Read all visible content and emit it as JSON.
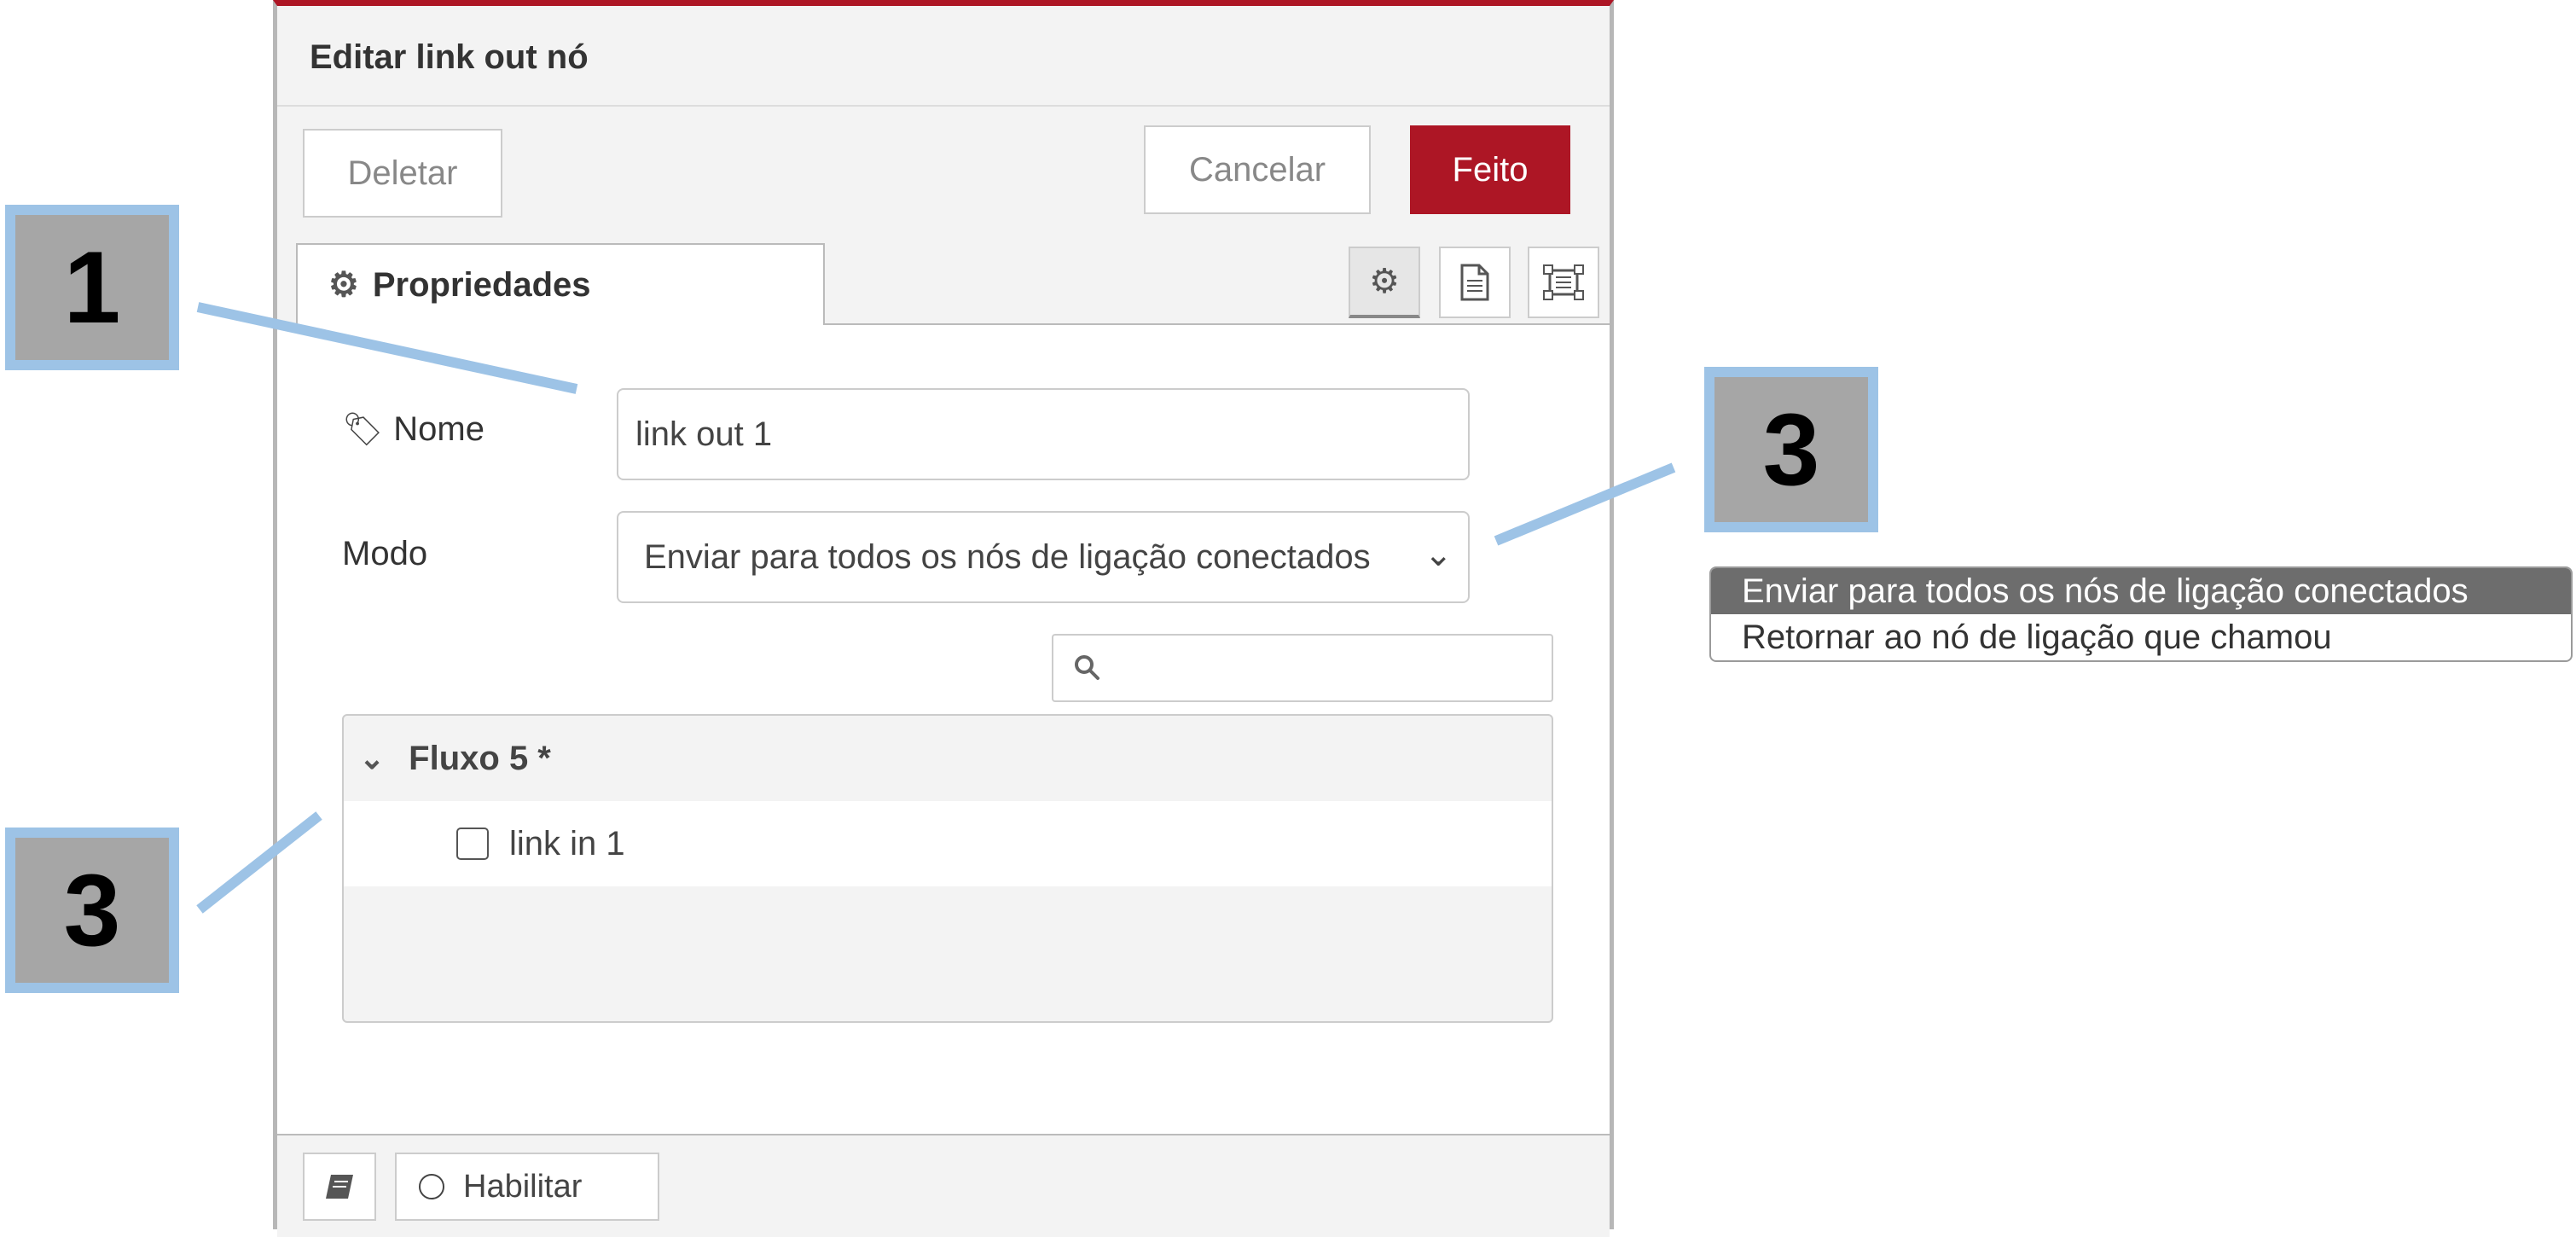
{
  "editor": {
    "title": "Editar link out nó",
    "buttons": {
      "delete": "Deletar",
      "cancel": "Cancelar",
      "done": "Feito"
    },
    "tabs": {
      "properties_label": "Propriedades",
      "icons": [
        "gear-icon",
        "document-icon",
        "frame-icon"
      ]
    },
    "form": {
      "name_label": "Nome",
      "name_value": "link out 1",
      "mode_label": "Modo",
      "mode_value": "Enviar para todos os nós de ligação conectados"
    },
    "search": {
      "placeholder": ""
    },
    "tree": {
      "group_label": "Fluxo 5 *",
      "items": [
        {
          "label": "link in 1",
          "checked": false
        }
      ]
    },
    "footer": {
      "enable_label": "Habilitar"
    },
    "colors": {
      "accent": "#ad1625",
      "callout_fill": "#a6a6a6",
      "callout_border": "#9dc3e6"
    }
  },
  "callouts": {
    "first": "1",
    "second": "3",
    "third": "3"
  },
  "dropdown": {
    "options": [
      {
        "label": "Enviar para todos os nós de ligação conectados",
        "selected": true
      },
      {
        "label": "Retornar ao nó de ligação que chamou",
        "selected": false
      }
    ]
  }
}
